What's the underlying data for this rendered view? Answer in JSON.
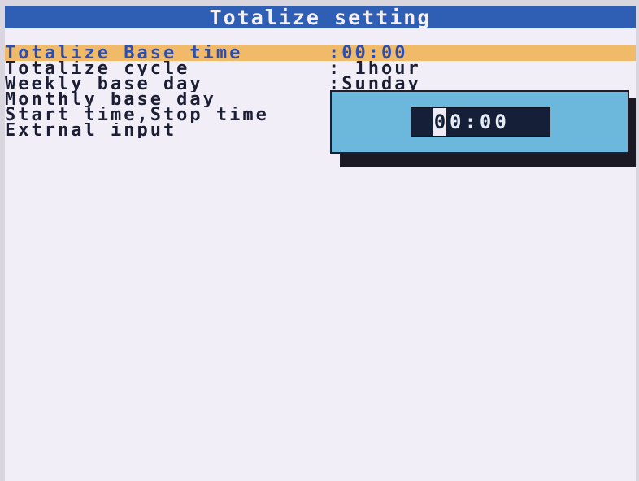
{
  "header": {
    "title": "Totalize setting"
  },
  "menu": {
    "items": [
      {
        "label": "Totalize Base time",
        "value": ":00:00"
      },
      {
        "label": "Totalize cycle",
        "value": ":  1hour"
      },
      {
        "label": "Weekly base day",
        "value": ":Sunday"
      },
      {
        "label": "Monthly base day",
        "value": ""
      },
      {
        "label": "Start time,Stop time",
        "value": ""
      },
      {
        "label": "Extrnal input",
        "value": ""
      }
    ],
    "selected_index": 0
  },
  "popup": {
    "time_cursor_digit": "0",
    "time_rest": "0:00"
  },
  "colors": {
    "title_bar": "#2f5fb4",
    "highlight": "#f0ba69",
    "popup": "#6bb8dc",
    "time_box": "#152038"
  }
}
